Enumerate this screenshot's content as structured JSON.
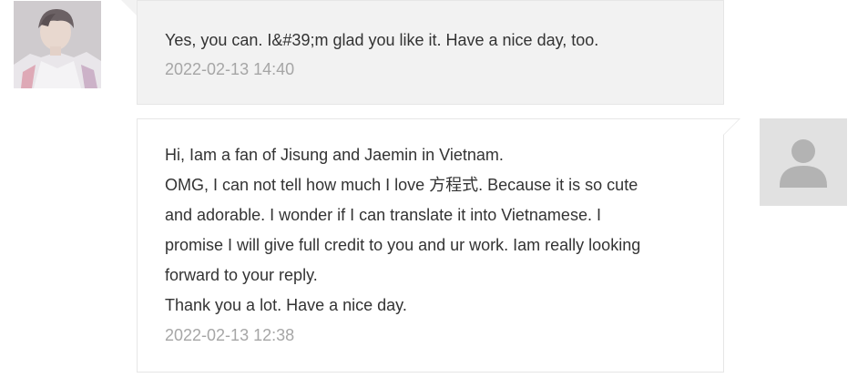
{
  "messages": [
    {
      "side": "left",
      "lines": [
        "Yes, you can. I&#39;m glad you like it. Have a nice day, too."
      ],
      "timestamp": "2022-02-13 14:40",
      "avatar_icon": "user-photo"
    },
    {
      "side": "right",
      "lines": [
        "Hi, Iam a fan of Jisung and Jaemin in Vietnam.",
        "OMG, I can not tell how much I love 方程式. Because it is so cute",
        "and adorable. I wonder if I can translate it into Vietnamese. I",
        "promise I will give full credit to you and ur work. Iam really looking",
        "forward to your reply.",
        "Thank you a lot. Have a nice day."
      ],
      "timestamp": "2022-02-13 12:38",
      "avatar_icon": "default-user-icon"
    }
  ],
  "colors": {
    "left_bubble_bg": "#f2f2f2",
    "right_bubble_bg": "#ffffff",
    "border": "#e6e6e6",
    "text": "#333333",
    "timestamp": "#a6a6a6",
    "default_avatar_bg": "#e1e1e1",
    "default_avatar_glyph": "#b3b3b3"
  }
}
